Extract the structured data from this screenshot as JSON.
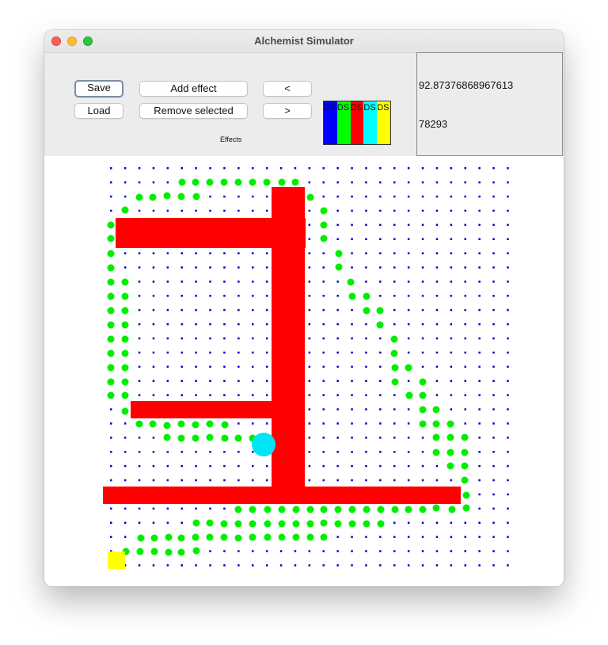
{
  "window": {
    "title": "Alchemist Simulator"
  },
  "toolbar": {
    "save_label": "Save",
    "load_label": "Load",
    "add_effect_label": "Add effect",
    "remove_selected_label": "Remove selected",
    "prev_label": "<",
    "next_label": ">",
    "effects_label": "Effects"
  },
  "palette": [
    {
      "label": "DS",
      "color": "#0000ff"
    },
    {
      "label": "DS",
      "color": "#00ff00"
    },
    {
      "label": "DS",
      "color": "#ff0000"
    },
    {
      "label": "DS",
      "color": "#00ffff"
    },
    {
      "label": "DS",
      "color": "#ffff00"
    }
  ],
  "info": {
    "value": "92.87376868967613",
    "step": "78293"
  },
  "colors": {
    "node": "#0000cc",
    "molecule": "#00ee00",
    "obstacle": "#ff0000",
    "agent": "#00e5f5",
    "target": "#ffff00"
  }
}
